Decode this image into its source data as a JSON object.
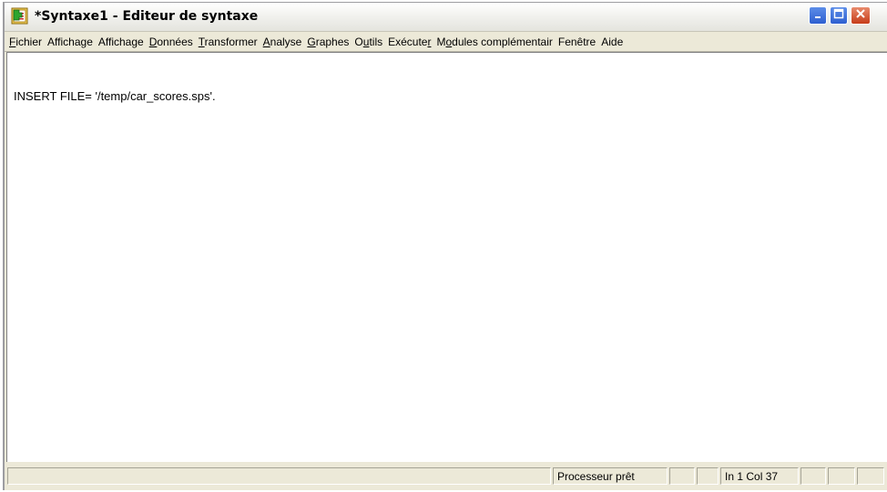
{
  "window": {
    "title": "*Syntaxe1 - Editeur de syntaxe"
  },
  "menubar": {
    "items": [
      {
        "label": "Fichier",
        "mnemonic_index": 0
      },
      {
        "label": "Affichage",
        "mnemonic_index": 7
      },
      {
        "label": "Affichage",
        "mnemonic_index": -1
      },
      {
        "label": "Données",
        "mnemonic_index": 0
      },
      {
        "label": "Transformer",
        "mnemonic_index": 0
      },
      {
        "label": "Analyse",
        "mnemonic_index": 0
      },
      {
        "label": "Graphes",
        "mnemonic_index": 0
      },
      {
        "label": "Outils",
        "mnemonic_index": 1
      },
      {
        "label": "Exécuter",
        "mnemonic_index": 7
      },
      {
        "label": "Modules complémentair",
        "mnemonic_index": 1
      },
      {
        "label": "Fenêtre",
        "mnemonic_index": -1
      },
      {
        "label": "Aide",
        "mnemonic_index": -1
      }
    ]
  },
  "editor": {
    "lines": [
      "INSERT FILE= '/temp/car_scores.sps'."
    ]
  },
  "statusbar": {
    "panels": [
      "",
      "Processeur prêt",
      "",
      "",
      "In 1 Col 37",
      "",
      "",
      ""
    ]
  },
  "icons": {
    "app": "syntax-editor-icon",
    "minimize": "minimize-icon",
    "maximize": "maximize-icon",
    "close": "close-icon"
  },
  "colors": {
    "titlebar_bg": "#f3f3f0",
    "window_bg": "#ece9d8",
    "editor_bg": "#ffffff",
    "close_button": "#c63d1a",
    "caption_button": "#2e5fd0"
  }
}
